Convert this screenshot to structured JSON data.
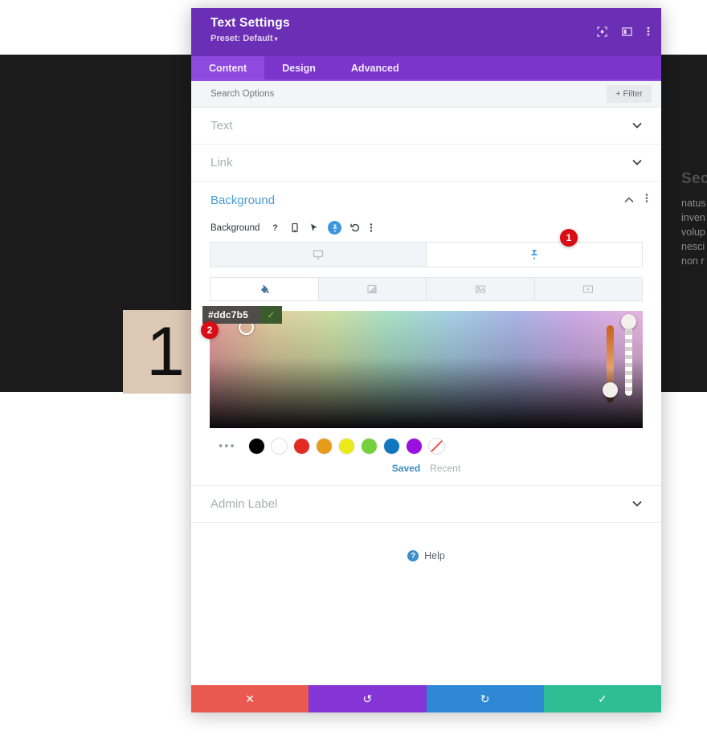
{
  "page_background": {
    "number_block_label": "1",
    "number_block_color": "#ddc7b5",
    "right_column_heading": "Sec",
    "right_column_lines": [
      "natus",
      "inven",
      "volup",
      "nesci",
      "non r"
    ]
  },
  "modal": {
    "title": "Text Settings",
    "preset_label": "Preset: Default",
    "preset_carat": "▾",
    "header_icons": [
      {
        "name": "expand-icon",
        "glyph": "⬚"
      },
      {
        "name": "layout-icon",
        "glyph": "▥"
      },
      {
        "name": "more-options-icon",
        "glyph": "⋮"
      }
    ],
    "tabs": [
      {
        "label": "Content",
        "active": true
      },
      {
        "label": "Design",
        "active": false
      },
      {
        "label": "Advanced",
        "active": false
      }
    ],
    "search": {
      "placeholder": "Search Options",
      "value": "",
      "filter_label": "+ Filter"
    },
    "sections": [
      {
        "label": "Text",
        "open": false
      },
      {
        "label": "Link",
        "open": false
      }
    ],
    "background_section": {
      "title": "Background",
      "collapse_glyph": "⌃",
      "menu_glyph": "⋮",
      "control_label": "Background",
      "control_icons": [
        {
          "name": "help-icon",
          "glyph": "?"
        },
        {
          "name": "responsive-icon",
          "glyph": "▯"
        },
        {
          "name": "hover-cursor-icon",
          "glyph": "➤"
        },
        {
          "name": "sticky-pin-icon",
          "glyph": "⚑",
          "active": true
        },
        {
          "name": "reset-icon",
          "glyph": "↺"
        },
        {
          "name": "more-icon",
          "glyph": "⋮"
        }
      ],
      "device_tabs": [
        {
          "name": "desktop-tab",
          "glyph": "⬜",
          "active": false
        },
        {
          "name": "sticky-tab",
          "glyph": "⚑",
          "active": true
        }
      ],
      "type_tabs": [
        {
          "name": "background-color-tab",
          "glyph": "◐",
          "active": true
        },
        {
          "name": "background-gradient-tab",
          "glyph": "◤",
          "active": false
        },
        {
          "name": "background-image-tab",
          "glyph": "⛰",
          "active": false
        },
        {
          "name": "background-video-tab",
          "glyph": "▶",
          "active": false
        }
      ],
      "color_picker": {
        "hex_value": "#ddc7b5",
        "confirm_glyph": "✓",
        "swatches": [
          {
            "name": "swatch-black",
            "color": "#000000"
          },
          {
            "name": "swatch-white",
            "color": "#ffffff"
          },
          {
            "name": "swatch-red",
            "color": "#e02b20"
          },
          {
            "name": "swatch-orange",
            "color": "#e59a18"
          },
          {
            "name": "swatch-yellow",
            "color": "#ece919"
          },
          {
            "name": "swatch-green",
            "color": "#73d13d"
          },
          {
            "name": "swatch-blue",
            "color": "#1176c0"
          },
          {
            "name": "swatch-purple",
            "color": "#9b10e0"
          },
          {
            "name": "swatch-transparent",
            "color": "transparent"
          }
        ],
        "more_glyph": "•••",
        "palette_tabs": [
          {
            "label": "Saved",
            "active": true
          },
          {
            "label": "Recent",
            "active": false
          }
        ]
      }
    },
    "admin_label_section": {
      "label": "Admin Label",
      "open": false
    },
    "help": {
      "label": "Help",
      "icon_glyph": "?"
    },
    "footer_buttons": [
      {
        "name": "discard-button",
        "glyph": "✕",
        "color": "#e9594f"
      },
      {
        "name": "undo-button",
        "glyph": "↺",
        "color": "#8535d6"
      },
      {
        "name": "redo-button",
        "glyph": "↻",
        "color": "#2f88d4"
      },
      {
        "name": "save-button",
        "glyph": "✓",
        "color": "#2fbd96"
      }
    ]
  },
  "annotations": [
    {
      "name": "badge-1",
      "label": "1"
    },
    {
      "name": "badge-2",
      "label": "2"
    }
  ]
}
